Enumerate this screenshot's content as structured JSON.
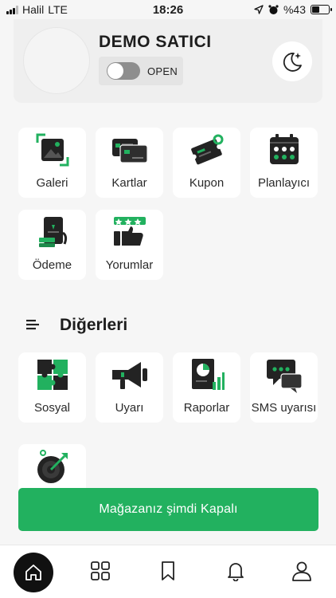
{
  "status_bar": {
    "carrier": "Halil",
    "network": "LTE",
    "time": "18:26",
    "battery": "%43"
  },
  "header": {
    "seller_name": "DEMO SATICI",
    "store_toggle_label": "OPEN",
    "store_open": false
  },
  "top_tiles": [
    {
      "label": "Galeri",
      "icon": "gallery-icon"
    },
    {
      "label": "Kartlar",
      "icon": "cards-icon"
    },
    {
      "label": "Kupon",
      "icon": "coupon-icon"
    },
    {
      "label": "Planlayıcı",
      "icon": "planner-icon"
    },
    {
      "label": "Ödeme",
      "icon": "payment-icon"
    },
    {
      "label": "Yorumlar",
      "icon": "reviews-icon"
    }
  ],
  "others_section": {
    "title": "Diğerleri",
    "tiles": [
      {
        "label": "Sosyal",
        "icon": "social-puzzle-icon"
      },
      {
        "label": "Uyarı",
        "icon": "megaphone-icon"
      },
      {
        "label": "Raporlar",
        "icon": "reports-icon"
      },
      {
        "label": "SMS uyarısı",
        "icon": "sms-icon"
      },
      {
        "label": "",
        "icon": "target-icon"
      }
    ]
  },
  "store_status_button": "Mağazanız şimdi Kapalı",
  "bottom_nav": [
    "home-icon",
    "grid-icon",
    "bookmark-icon",
    "bell-icon",
    "profile-icon"
  ],
  "colors": {
    "accent": "#22b15f",
    "background": "#f6f6f6",
    "icon_dark": "#232323"
  }
}
